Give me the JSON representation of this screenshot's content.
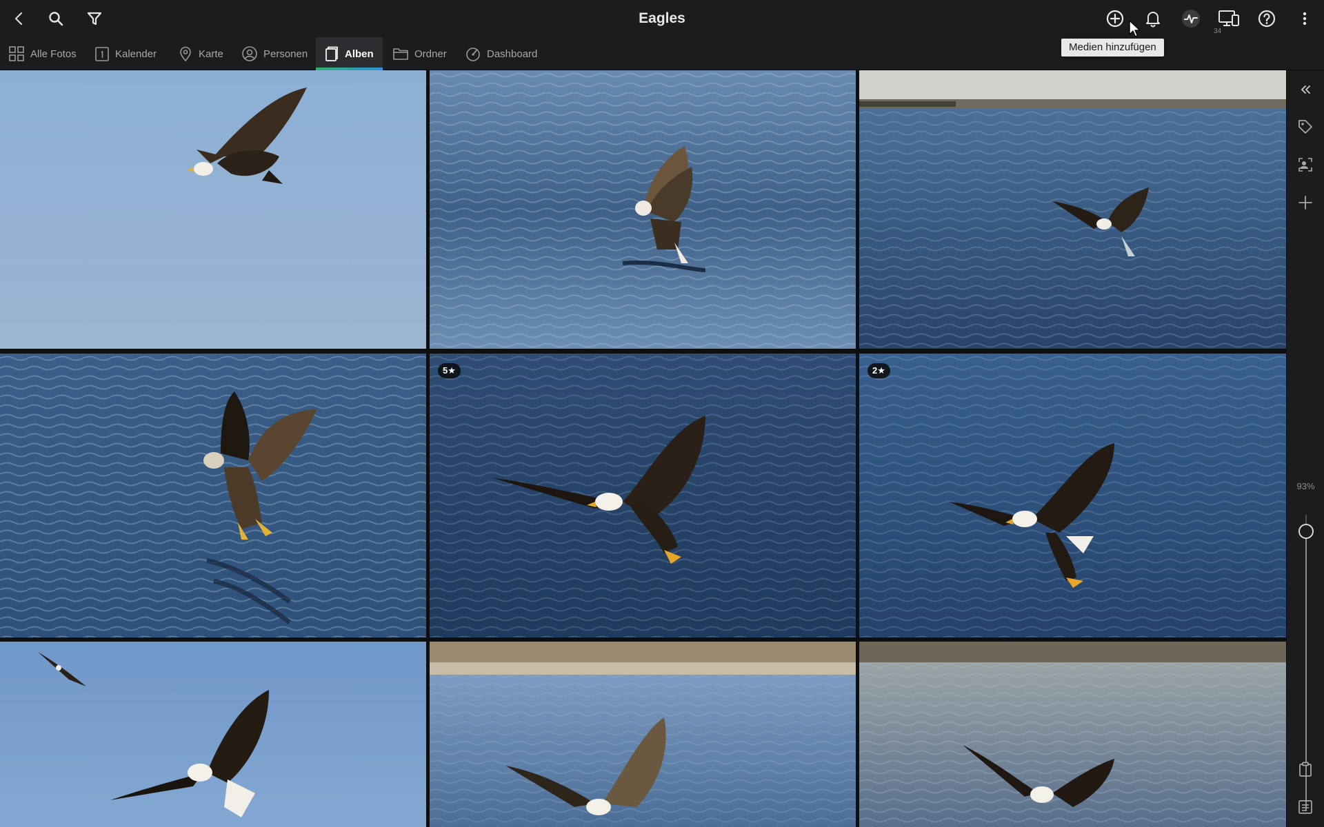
{
  "window": {
    "title": "Eagles"
  },
  "toolbar": {
    "add_media_tooltip": "Medien hinzufügen",
    "device_badge": "34"
  },
  "nav": {
    "items": [
      {
        "label": "Alle Fotos",
        "icon": "grid-icon"
      },
      {
        "label": "Kalender",
        "icon": "calendar-icon"
      },
      {
        "label": "Karte",
        "icon": "map-pin-icon"
      },
      {
        "label": "Personen",
        "icon": "person-icon"
      },
      {
        "label": "Alben",
        "icon": "album-icon",
        "active": true
      },
      {
        "label": "Ordner",
        "icon": "folder-icon"
      },
      {
        "label": "Dashboard",
        "icon": "dashboard-icon"
      }
    ]
  },
  "photos": [
    {
      "id": 1,
      "rating": ""
    },
    {
      "id": 2,
      "rating": ""
    },
    {
      "id": 3,
      "rating": ""
    },
    {
      "id": 4,
      "rating": ""
    },
    {
      "id": 5,
      "rating": "5★"
    },
    {
      "id": 6,
      "rating": "2★"
    },
    {
      "id": 7,
      "rating": ""
    },
    {
      "id": 8,
      "rating": ""
    },
    {
      "id": 9,
      "rating": ""
    }
  ],
  "sidebar": {
    "zoom_label": "93%",
    "zoom_value": 0.93
  },
  "colors": {
    "accent_start": "#2fb36b",
    "accent_end": "#2f8fe0",
    "sky": "#8fb0d2",
    "water": "#2e4d72"
  }
}
